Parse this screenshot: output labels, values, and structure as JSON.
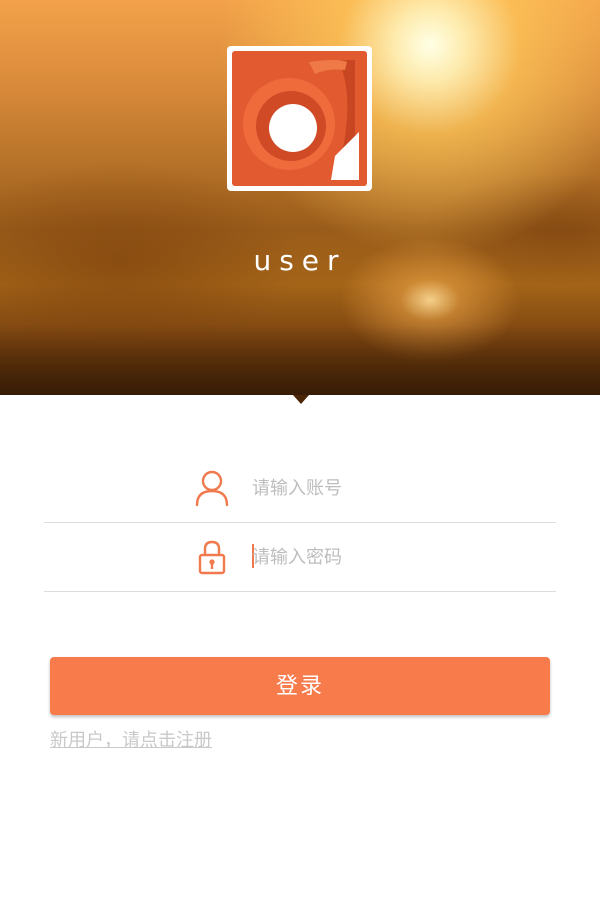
{
  "header": {
    "username": "user",
    "background_accent": "#e08a3a"
  },
  "logo": {
    "icon": "app-logo-icon",
    "color": "#e8603a"
  },
  "form": {
    "account": {
      "icon": "user-icon",
      "placeholder": "请输入账号",
      "value": ""
    },
    "password": {
      "icon": "lock-icon",
      "placeholder": "请输入密码",
      "value": ""
    }
  },
  "login_button": {
    "label": "登录",
    "color": "#f87b4c"
  },
  "register_link": {
    "label": "新用户，请点击注册"
  }
}
